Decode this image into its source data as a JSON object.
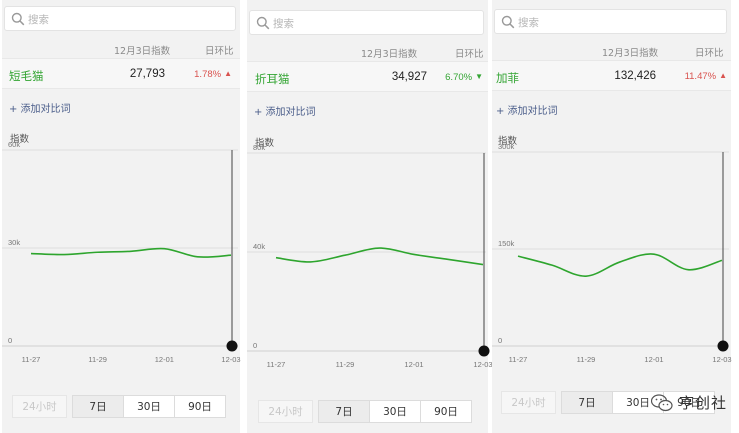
{
  "panels": [
    {
      "search_placeholder": "搜索",
      "header_date": "12月3日指数",
      "header_change": "日环比",
      "breed": "短毛猫",
      "value": "27,793",
      "change": "1.78%",
      "direction": "up",
      "add_compare": "+ 添加对比词",
      "index_label": "指数",
      "ymax_label": "60k",
      "ymid_label": "30k",
      "ymin_label": "0",
      "x_labels": [
        "11-27",
        "11-29",
        "12-01",
        "12-03"
      ],
      "range_buttons": [
        "24小时",
        "7日",
        "30日",
        "90日"
      ],
      "selected_range": "7日"
    },
    {
      "search_placeholder": "搜索",
      "header_date": "12月3日指数",
      "header_change": "日环比",
      "breed": "折耳猫",
      "value": "34,927",
      "change": "6.70%",
      "direction": "down",
      "add_compare": "+ 添加对比词",
      "index_label": "指数",
      "ymax_label": "80k",
      "ymid_label": "40k",
      "ymin_label": "0",
      "x_labels": [
        "11-27",
        "11-29",
        "12-01",
        "12-03"
      ],
      "range_buttons": [
        "24小时",
        "7日",
        "30日",
        "90日"
      ],
      "selected_range": "7日"
    },
    {
      "search_placeholder": "搜索",
      "header_date": "12月3日指数",
      "header_change": "日环比",
      "breed": "加菲",
      "value": "132,426",
      "change": "11.47%",
      "direction": "up",
      "add_compare": "+ 添加对比词",
      "index_label": "指数",
      "ymax_label": "300k",
      "ymid_label": "150k",
      "ymin_label": "0",
      "x_labels": [
        "11-27",
        "11-29",
        "12-01",
        "12-03"
      ],
      "range_buttons": [
        "24小时",
        "7日",
        "30日",
        "90日"
      ],
      "selected_range": "7日"
    }
  ],
  "watermark": "亨创社",
  "colors": {
    "line": "#2ea52e",
    "up": "#d9534f",
    "down": "#34a534",
    "name": "#34a534",
    "link": "#4a5d8a"
  },
  "chart_data": [
    {
      "type": "line",
      "x": [
        "11-27",
        "11-28",
        "11-29",
        "11-30",
        "12-01",
        "12-02",
        "12-03"
      ],
      "series": [
        {
          "values": [
            28300,
            28000,
            28700,
            29000,
            29800,
            27300,
            27793
          ]
        }
      ],
      "ylim": [
        0,
        60000
      ]
    },
    {
      "type": "line",
      "x": [
        "11-27",
        "11-28",
        "11-29",
        "11-30",
        "12-01",
        "12-02",
        "12-03"
      ],
      "series": [
        {
          "values": [
            37700,
            36000,
            38700,
            41600,
            39000,
            37000,
            34927
          ]
        }
      ],
      "ylim": [
        0,
        80000
      ]
    },
    {
      "type": "line",
      "x": [
        "11-27",
        "11-28",
        "11-29",
        "11-30",
        "12-01",
        "12-02",
        "12-03"
      ],
      "series": [
        {
          "values": [
            139000,
            125000,
            108000,
            130000,
            142000,
            118000,
            132426
          ]
        }
      ],
      "ylim": [
        0,
        300000
      ]
    }
  ]
}
